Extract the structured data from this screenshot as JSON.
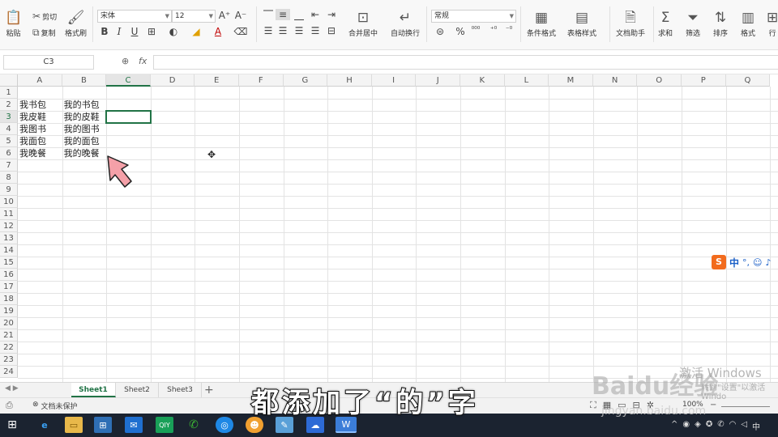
{
  "ribbon": {
    "paste": "粘贴",
    "cut": "剪切",
    "copy": "复制",
    "format_painter": "格式刷",
    "font_name": "宋体",
    "font_size": "12",
    "merge_center": "合并居中",
    "wrap_text": "自动换行",
    "number_format": "常规",
    "conditional_format": "条件格式",
    "table_style": "表格样式",
    "doc_helper": "文档助手",
    "sum": "求和",
    "filter": "筛选",
    "sort": "排序",
    "format": "格式",
    "row": "行"
  },
  "formula_bar": {
    "name_box": "C3",
    "fx": "fx",
    "value": ""
  },
  "columns": [
    "A",
    "B",
    "C",
    "D",
    "E",
    "F",
    "G",
    "H",
    "I",
    "J",
    "K",
    "L",
    "M",
    "N",
    "O",
    "P",
    "Q"
  ],
  "rows": [
    "1",
    "2",
    "3",
    "4",
    "5",
    "6",
    "7",
    "8",
    "9",
    "10",
    "11",
    "12",
    "13",
    "14",
    "15",
    "16",
    "17",
    "18",
    "19",
    "20",
    "21",
    "22",
    "23",
    "24"
  ],
  "selected_cell": "C3",
  "cells": {
    "A2": "我书包",
    "B2": "我的书包",
    "A3": "我皮鞋",
    "B3": "我的皮鞋",
    "A4": "我图书",
    "B4": "我的图书",
    "A5": "我面包",
    "B5": "我的面包",
    "A6": "我晚餐",
    "B6": "我的晚餐"
  },
  "sheets": [
    "Sheet1",
    "Sheet2",
    "Sheet3"
  ],
  "active_sheet": "Sheet1",
  "status": {
    "protect": "文档未保护",
    "zoom": "100%"
  },
  "ime": {
    "label": "中"
  },
  "caption": "都添加了“的”字",
  "watermark": {
    "activate": "激活 Windows",
    "activate_sub": "转到\"设置\"以激活 Windo",
    "site": "Baidu经验",
    "url": "jingyan.baidu.com"
  },
  "colors": {
    "accent": "#217346",
    "taskbar": "#1b2330",
    "arrow": "#f4a0a8"
  }
}
